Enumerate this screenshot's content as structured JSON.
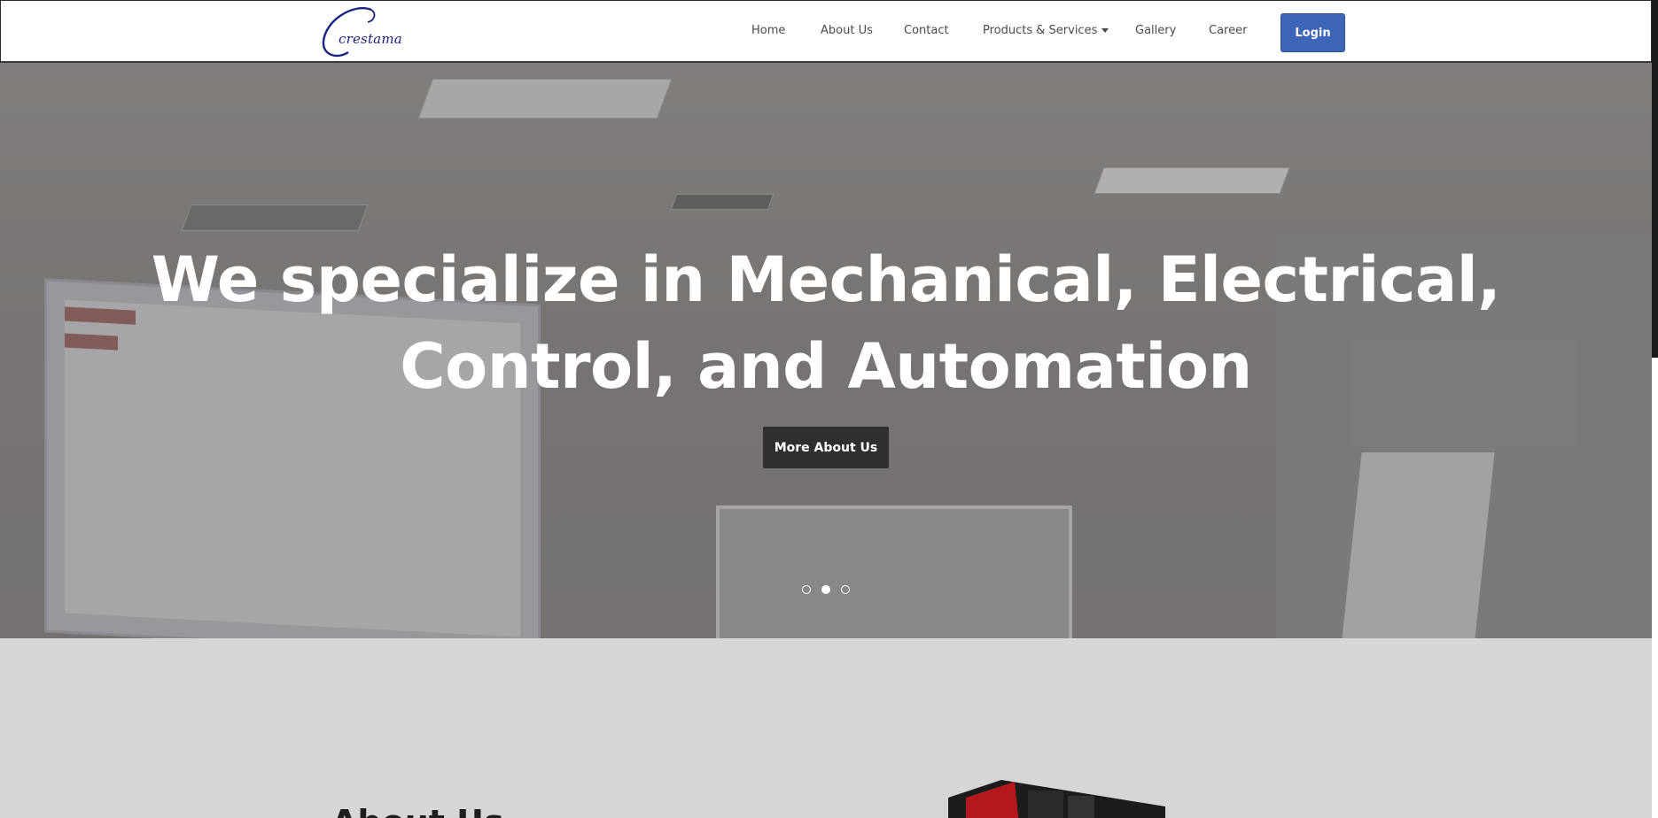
{
  "header": {
    "logo_text": "crestama",
    "nav": {
      "home": "Home",
      "about": "About Us",
      "contact": "Contact",
      "products": "Products & Services",
      "gallery": "Gallery",
      "career": "Career"
    },
    "login_label": "Login"
  },
  "hero": {
    "title_line1": "We specialize in Mechanical, Electrical,",
    "title_line2": "Control, and Automation",
    "button_label": "More About Us",
    "slides": [
      {
        "active": false
      },
      {
        "active": true
      },
      {
        "active": false
      }
    ]
  },
  "about": {
    "heading": "About Us"
  },
  "colors": {
    "accent": "#3e66b8",
    "logo": "#1b2380",
    "dark_button": "#2f2f2f",
    "section_bg": "#d6d6d6"
  }
}
